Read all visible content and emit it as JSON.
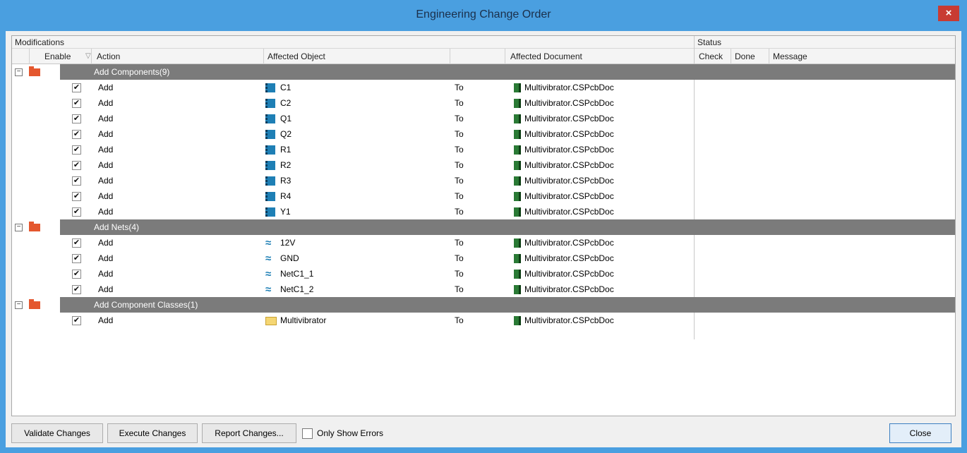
{
  "window": {
    "title": "Engineering Change Order",
    "close_glyph": "×"
  },
  "headers": {
    "groups": {
      "modifications": "Modifications",
      "status": "Status"
    },
    "columns": {
      "enable": "Enable",
      "filter_glyph": "▽",
      "action": "Action",
      "affected_object": "Affected Object",
      "affected_document": "Affected Document",
      "check": "Check",
      "done": "Done",
      "message": "Message"
    }
  },
  "groups": [
    {
      "label": "Add Components(9)",
      "icon": "folder-icon",
      "rows": [
        {
          "enabled": true,
          "action": "Add",
          "object": "C1",
          "object_icon": "component-icon",
          "to": "To",
          "document": "Multivibrator.CSPcbDoc"
        },
        {
          "enabled": true,
          "action": "Add",
          "object": "C2",
          "object_icon": "component-icon",
          "to": "To",
          "document": "Multivibrator.CSPcbDoc"
        },
        {
          "enabled": true,
          "action": "Add",
          "object": "Q1",
          "object_icon": "component-icon",
          "to": "To",
          "document": "Multivibrator.CSPcbDoc"
        },
        {
          "enabled": true,
          "action": "Add",
          "object": "Q2",
          "object_icon": "component-icon",
          "to": "To",
          "document": "Multivibrator.CSPcbDoc"
        },
        {
          "enabled": true,
          "action": "Add",
          "object": "R1",
          "object_icon": "component-icon",
          "to": "To",
          "document": "Multivibrator.CSPcbDoc"
        },
        {
          "enabled": true,
          "action": "Add",
          "object": "R2",
          "object_icon": "component-icon",
          "to": "To",
          "document": "Multivibrator.CSPcbDoc"
        },
        {
          "enabled": true,
          "action": "Add",
          "object": "R3",
          "object_icon": "component-icon",
          "to": "To",
          "document": "Multivibrator.CSPcbDoc"
        },
        {
          "enabled": true,
          "action": "Add",
          "object": "R4",
          "object_icon": "component-icon",
          "to": "To",
          "document": "Multivibrator.CSPcbDoc"
        },
        {
          "enabled": true,
          "action": "Add",
          "object": "Y1",
          "object_icon": "component-icon",
          "to": "To",
          "document": "Multivibrator.CSPcbDoc"
        }
      ]
    },
    {
      "label": "Add Nets(4)",
      "icon": "folder-icon",
      "rows": [
        {
          "enabled": true,
          "action": "Add",
          "object": "12V",
          "object_icon": "net-icon",
          "to": "To",
          "document": "Multivibrator.CSPcbDoc"
        },
        {
          "enabled": true,
          "action": "Add",
          "object": "GND",
          "object_icon": "net-icon",
          "to": "To",
          "document": "Multivibrator.CSPcbDoc"
        },
        {
          "enabled": true,
          "action": "Add",
          "object": "NetC1_1",
          "object_icon": "net-icon",
          "to": "To",
          "document": "Multivibrator.CSPcbDoc"
        },
        {
          "enabled": true,
          "action": "Add",
          "object": "NetC1_2",
          "object_icon": "net-icon",
          "to": "To",
          "document": "Multivibrator.CSPcbDoc"
        }
      ]
    },
    {
      "label": "Add Component Classes(1)",
      "icon": "folder-icon",
      "rows": [
        {
          "enabled": true,
          "action": "Add",
          "object": "Multivibrator",
          "object_icon": "folder-icon",
          "to": "To",
          "document": "Multivibrator.CSPcbDoc"
        }
      ]
    }
  ],
  "footer": {
    "validate_label": "Validate Changes",
    "execute_label": "Execute Changes",
    "report_label": "Report Changes...",
    "only_errors_label": "Only Show Errors",
    "only_errors_checked": false,
    "close_label": "Close"
  }
}
